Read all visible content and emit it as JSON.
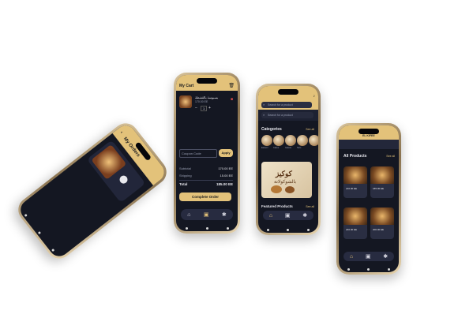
{
  "phone1": {
    "header_title": "My Orders",
    "header_back": "‹"
  },
  "phone2": {
    "header_title": "My Cart",
    "item_name": "بسبوسة بالقشطة",
    "item_price": "170.00 EE",
    "item_qty": "1",
    "coupon_placeholder": "Coupon Code",
    "apply_label": "Apply",
    "subtotal_label": "Subtotal",
    "subtotal_value": "170.00 EE",
    "shipping_label": "Shipping",
    "shipping_value": "15.00 EE",
    "total_label": "Total",
    "total_value": "185.00 EE",
    "complete_label": "Complete Order"
  },
  "phone3": {
    "search_placeholder": "Search for a product",
    "categories_title": "Categories",
    "see_all_1": "See all",
    "category_labels": [
      "Eastern",
      "Cakes",
      "Gateau",
      "Tarts",
      "Gifts"
    ],
    "banner_text": "كوكيز",
    "banner_subtext": "بالشوكولاتة",
    "featured_title": "Featured Products",
    "see_all_2": "See all"
  },
  "phone4": {
    "brand": "EL KIFEE",
    "section_title": "All Products",
    "see_all": "See all",
    "prices": [
      "210.00 EE",
      "185.00 EE",
      "240.00 EE",
      "200.00 EE"
    ]
  },
  "colors": {
    "accent": "#e3c27a",
    "screen_bg": "#141722",
    "card_bg": "#2a2e42"
  }
}
